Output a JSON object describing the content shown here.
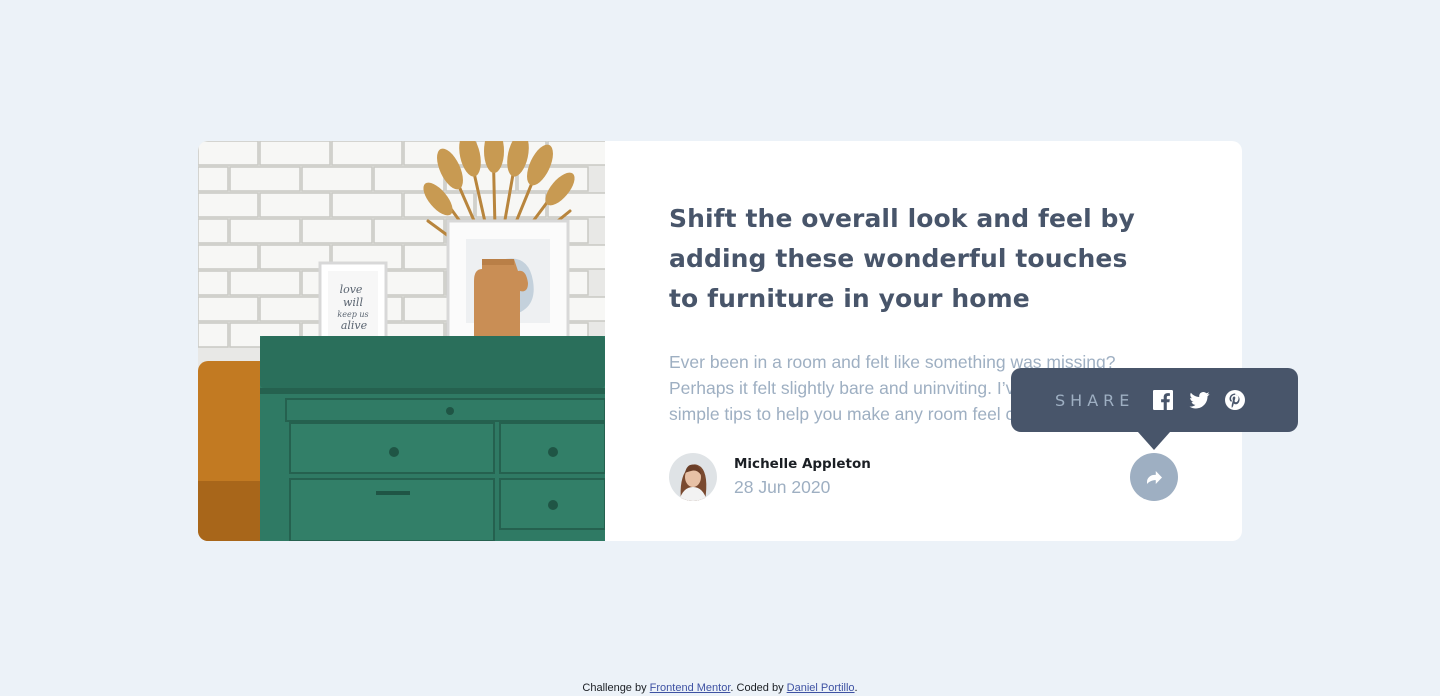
{
  "article": {
    "title": "Shift the overall look and feel by adding these wonderful touches to furniture in your home",
    "excerpt": "Ever been in a room and felt like something was missing? Perhaps it felt slightly bare and uninviting. I’ve got some simple tips to help you make any room feel complete.",
    "image_icon": "drawers-photo"
  },
  "author": {
    "name": "Michelle Appleton",
    "date": "28 Jun 2020",
    "avatar_icon": "avatar-photo"
  },
  "share": {
    "label": "SHARE",
    "button_icon": "share-icon",
    "icons": [
      "facebook-icon",
      "twitter-icon",
      "pinterest-icon"
    ]
  },
  "attribution": {
    "prefix": "Challenge by ",
    "link1": "Frontend Mentor",
    "middle": ". Coded by ",
    "link2": "Daniel Portillo",
    "suffix": "."
  },
  "colors": {
    "background": "#ecf2f8",
    "title": "#48556a",
    "muted": "#9eafc2",
    "tooltip": "#48556a",
    "link": "#3e52a3"
  }
}
